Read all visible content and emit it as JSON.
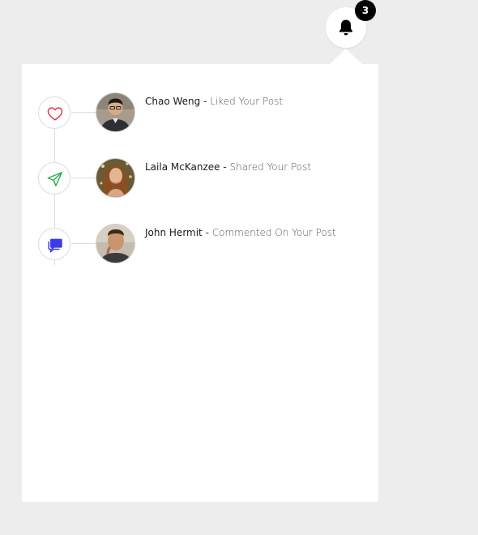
{
  "header": {
    "bell_icon": "bell-icon",
    "badge_count": "3"
  },
  "notifications": [
    {
      "icon": "heart-icon",
      "icon_color": "#e8334a",
      "name": "Chao Weng",
      "separator": " - ",
      "action": "Liked Your Post"
    },
    {
      "icon": "send-icon",
      "icon_color": "#2bb24c",
      "name": "Laila McKanzee",
      "separator": " - ",
      "action": "Shared Your Post"
    },
    {
      "icon": "comment-icon",
      "icon_color": "#3b3be8",
      "name": "John Hermit",
      "separator": " - ",
      "action": "Commented On Your Post"
    }
  ]
}
